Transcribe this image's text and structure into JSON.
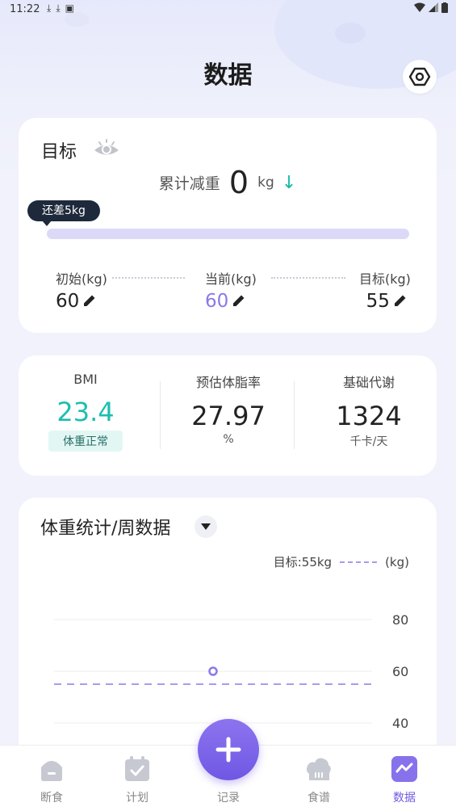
{
  "status_bar": {
    "time": "11:22",
    "icons": [
      "download-icon",
      "download-icon",
      "app-notification-icon"
    ],
    "right_icons": [
      "wifi-icon",
      "signal-icon",
      "battery-icon"
    ]
  },
  "header": {
    "title": "数据",
    "settings_icon": "hexagon-settings-icon"
  },
  "goal_card": {
    "title": "目标",
    "loss_label": "累计减重",
    "loss_value": "0",
    "loss_unit": "kg",
    "loss_arrow": "↓",
    "remain_tip": "还差5kg",
    "progress": 0,
    "initial": {
      "label": "初始(kg)",
      "value": "60"
    },
    "current": {
      "label": "当前(kg)",
      "value": "60"
    },
    "target": {
      "label": "目标(kg)",
      "value": "55"
    }
  },
  "metrics_card": {
    "bmi": {
      "label": "BMI",
      "value": "23.4",
      "badge": "体重正常"
    },
    "body_fat": {
      "label": "预估体脂率",
      "value": "27.97",
      "unit": "%"
    },
    "bmr": {
      "label": "基础代谢",
      "value": "1324",
      "unit": "千卡/天"
    }
  },
  "chart_card": {
    "title": "体重统计/周数据",
    "legend_label": "目标:55kg",
    "unit_label": "(kg)"
  },
  "chart_data": {
    "type": "line",
    "title": "体重统计/周数据",
    "ylabel": "(kg)",
    "y_ticks": [
      80,
      60,
      40
    ],
    "series": [
      {
        "values": [
          60
        ]
      }
    ],
    "target_line": {
      "name": "目标:55kg",
      "value": 55
    },
    "grid": true,
    "legend_position": "top-right"
  },
  "bottom_nav": {
    "items": [
      {
        "label": "断食",
        "icon": "bowl-icon",
        "active": false
      },
      {
        "label": "计划",
        "icon": "calendar-check-icon",
        "active": false
      },
      {
        "label": "记录",
        "icon": "plus-icon",
        "active": false
      },
      {
        "label": "食谱",
        "icon": "chef-hat-icon",
        "active": false
      },
      {
        "label": "数据",
        "icon": "chart-icon",
        "active": true
      }
    ]
  },
  "colors": {
    "accent": "#7057e4",
    "teal": "#1bbfb0",
    "target_line": "#a79ced"
  }
}
